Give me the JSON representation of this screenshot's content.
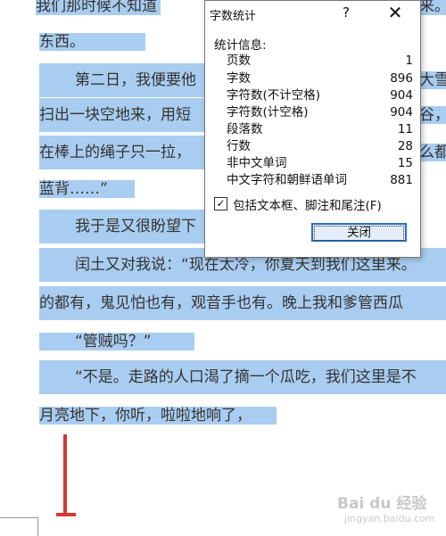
{
  "document": {
    "lines": [
      "我们那时候不知道",
      "东西。",
      "第二日，我便要他",
      "扫出一块空地来，用短",
      "在棒上的绳子只一拉，",
      "蓝背……”",
      "我于是又很盼望下",
      "闰土又对我说：“现在太冷，你夏天到我们这里来。",
      "的都有，鬼见怕也有，观音手也有。晚上我和爹管西瓜",
      "“管贼吗？”",
      "“不是。走路的人口渴了摘一个瓜吃，我们这里是不",
      "月亮地下，你听，啦啦地响了，"
    ],
    "right_fragments": {
      "line1": "来。",
      "line3": "大雪下",
      "line4": "谷，",
      "line5": "么都"
    }
  },
  "dialog": {
    "title": "字数统计",
    "help_label": "?",
    "close_label": "✕",
    "header": "统计信息:",
    "stats": [
      {
        "label": "页数",
        "value": "1"
      },
      {
        "label": "字数",
        "value": "896"
      },
      {
        "label": "字符数(不计空格)",
        "value": "904"
      },
      {
        "label": "字符数(计空格)",
        "value": "904"
      },
      {
        "label": "段落数",
        "value": "11"
      },
      {
        "label": "行数",
        "value": "28"
      },
      {
        "label": "非中文单词",
        "value": "15"
      },
      {
        "label": "中文字符和朝鲜语单词",
        "value": "881"
      }
    ],
    "checkbox_label": "包括文本框、脚注和尾注(F)",
    "checkbox_checked": "✓",
    "close_button": "关闭"
  },
  "watermark": {
    "brand": "Bai du 经验",
    "url": "jingyan.baidu.com"
  }
}
